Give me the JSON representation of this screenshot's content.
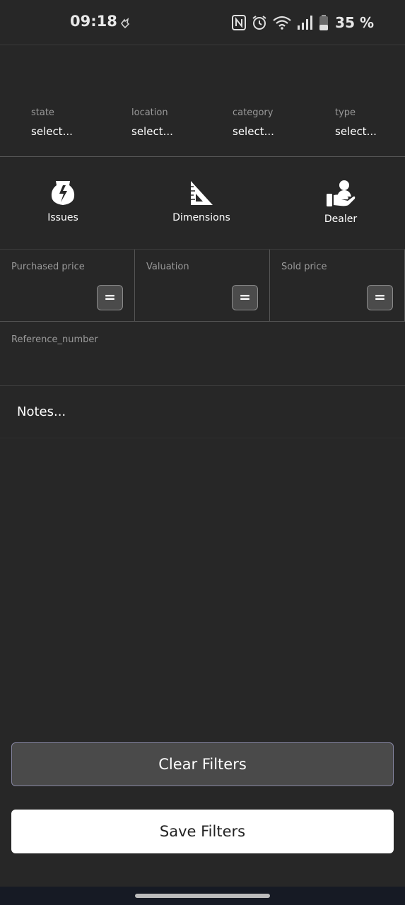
{
  "status_bar": {
    "time": "09:18",
    "battery": "35 %"
  },
  "filters": {
    "dropdowns": [
      {
        "label": "state",
        "value": "select..."
      },
      {
        "label": "location",
        "value": "select..."
      },
      {
        "label": "category",
        "value": "select..."
      },
      {
        "label": "type",
        "value": "select..."
      }
    ],
    "icon_buttons": [
      {
        "label": "Issues",
        "icon": "broken-vase-icon"
      },
      {
        "label": "Dimensions",
        "icon": "ruler-triangle-icon"
      },
      {
        "label": "Dealer",
        "icon": "dealer-hand-icon"
      }
    ],
    "prices": [
      {
        "label": "Purchased price",
        "operator": "="
      },
      {
        "label": "Valuation",
        "operator": "="
      },
      {
        "label": "Sold price",
        "operator": "="
      }
    ],
    "reference_label": "Reference_number",
    "notes_placeholder": "Notes..."
  },
  "actions": {
    "clear_label": "Clear Filters",
    "save_label": "Save Filters"
  },
  "colors": {
    "background": "#272727",
    "clear_button": "#4a4a4a",
    "save_button": "#ffffff"
  }
}
